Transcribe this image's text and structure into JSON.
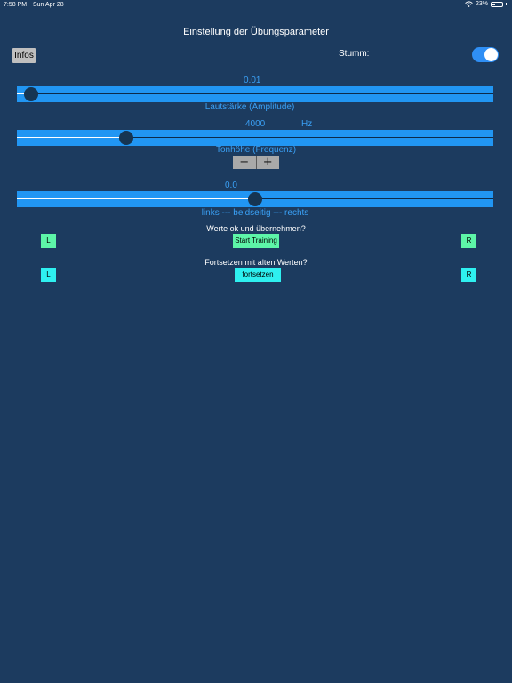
{
  "status": {
    "time": "7:58 PM",
    "date": "Sun Apr 28",
    "battery": "23%"
  },
  "title": "Einstellung der Übungsparameter",
  "infos_button": "Infos",
  "mute": {
    "label": "Stumm:",
    "on": true,
    "accent": "#2f8ff5"
  },
  "amplitude": {
    "value_label": "0.01",
    "caption": "Lautstärke (Amplitude)",
    "level": 0.03
  },
  "frequency": {
    "value_label": "4000",
    "unit": "Hz",
    "caption": "Tonhöhe (Frequenz)",
    "level": 0.23,
    "minus": "−",
    "plus": "+"
  },
  "balance": {
    "value_label": "0.0",
    "caption": "links --- beidseitig --- rechts",
    "level": 0.5
  },
  "start_section": {
    "prompt": "Werte ok und übernehmen?",
    "left": "L",
    "center": "Start Training",
    "right": "R",
    "color": "#5df5a8"
  },
  "continue_section": {
    "prompt": "Fortsetzen mit alten Werten?",
    "left": "L",
    "center": "fortsetzen",
    "right": "R",
    "color": "#2ef0f0"
  },
  "colors": {
    "background": "#1c3b5f",
    "slider": "#2196f3",
    "label": "#3aa0f5"
  }
}
